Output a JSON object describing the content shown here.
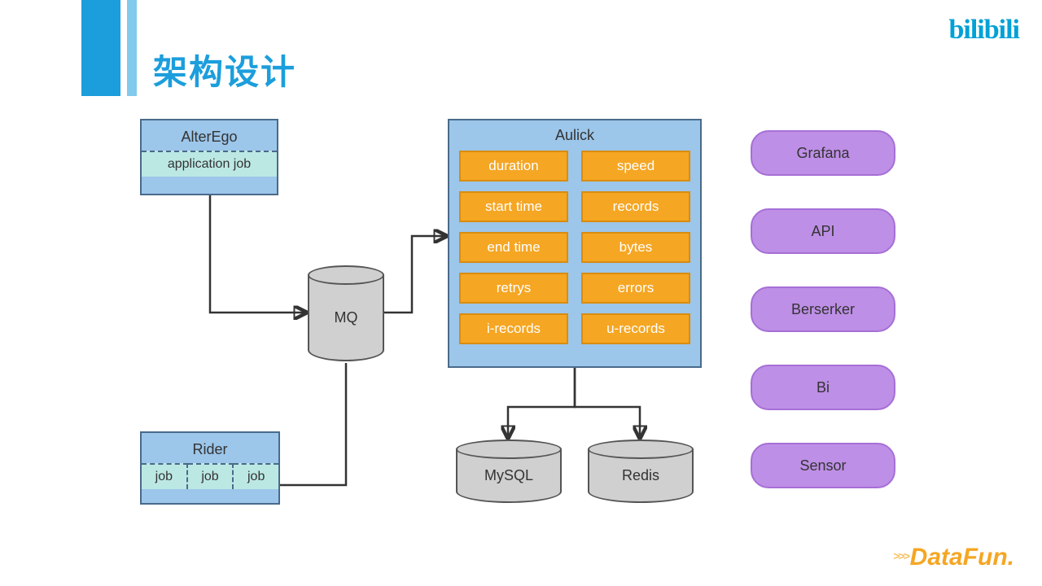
{
  "title": "架构设计",
  "logos": {
    "bilibili": "bilibili",
    "datafun": "DataFun."
  },
  "left": {
    "alterego": {
      "title": "AlterEgo",
      "sub": "application job"
    },
    "rider": {
      "title": "Rider",
      "jobs": [
        "job",
        "job",
        "job"
      ]
    }
  },
  "mq": "MQ",
  "aulick": {
    "title": "Aulick",
    "metrics_left": [
      "duration",
      "start time",
      "end time",
      "retrys",
      "i-records"
    ],
    "metrics_right": [
      "speed",
      "records",
      "bytes",
      "errors",
      "u-records"
    ]
  },
  "stores": {
    "mysql": "MySQL",
    "redis": "Redis"
  },
  "consumers": [
    "Grafana",
    "API",
    "Berserker",
    "Bi",
    "Sensor"
  ]
}
